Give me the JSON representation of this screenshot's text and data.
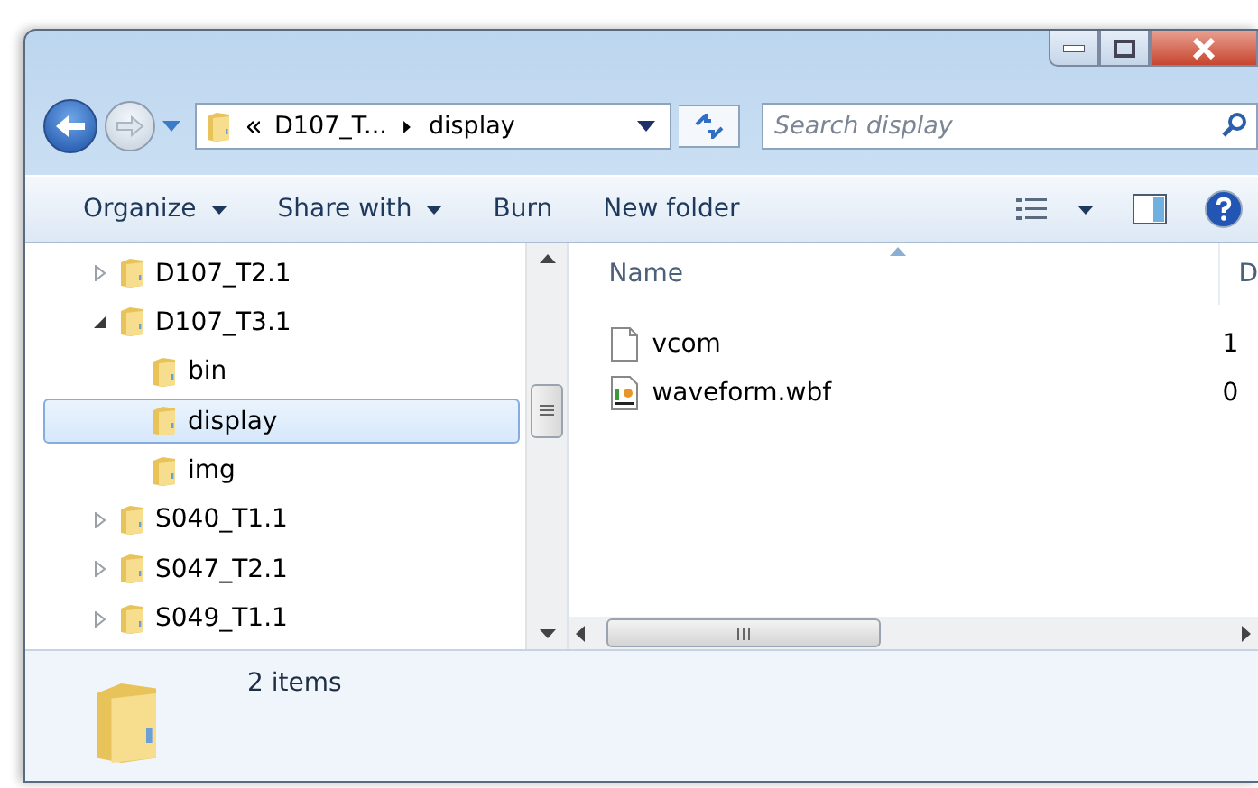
{
  "address": {
    "crumbs": [
      "D107_T...",
      "display"
    ]
  },
  "search": {
    "placeholder": "Search display"
  },
  "toolbar": [
    {
      "label": "Organize",
      "dropdown": true
    },
    {
      "label": "Share with",
      "dropdown": true
    },
    {
      "label": "Burn",
      "dropdown": false
    },
    {
      "label": "New folder",
      "dropdown": false
    }
  ],
  "tree": [
    {
      "label": "D107_T2.1",
      "expanded": false,
      "selected": false
    },
    {
      "label": "D107_T3.1",
      "expanded": true,
      "selected": false,
      "children": [
        {
          "label": "bin",
          "selected": false
        },
        {
          "label": "display",
          "selected": true
        },
        {
          "label": "img",
          "selected": false
        }
      ]
    },
    {
      "label": "S040_T1.1",
      "expanded": false,
      "selected": false
    },
    {
      "label": "S047_T2.1",
      "expanded": false,
      "selected": false
    },
    {
      "label": "S049_T1.1",
      "expanded": false,
      "selected": false
    }
  ],
  "table": {
    "columns": [
      "Name",
      "D"
    ],
    "rows": [
      {
        "kind": "file",
        "name": "vcom",
        "column_2": "1"
      },
      {
        "kind": "image",
        "name": "waveform.wbf",
        "column_2": "0"
      }
    ]
  },
  "status_bar": {
    "text": "2 items"
  }
}
